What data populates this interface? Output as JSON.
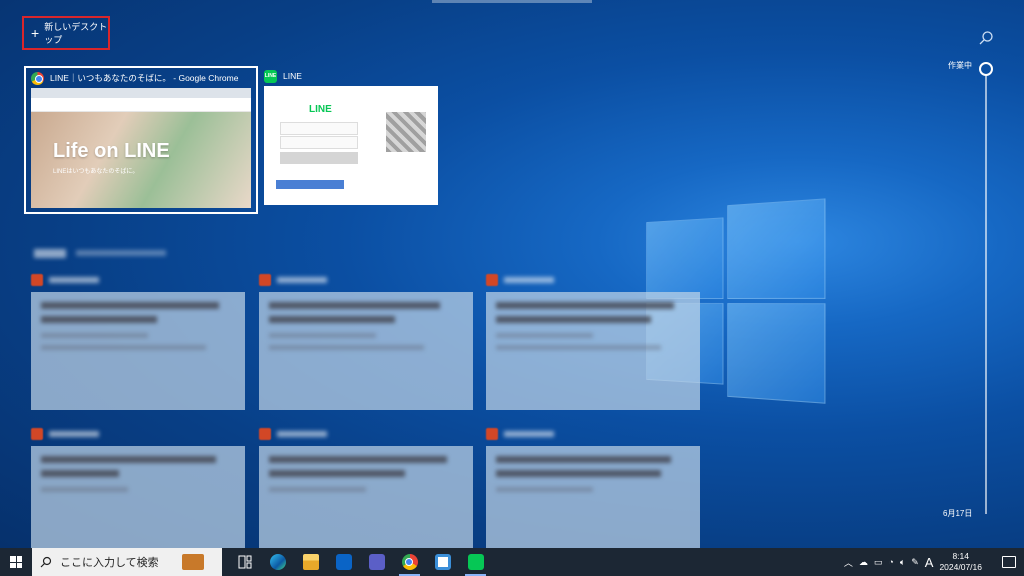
{
  "header": {
    "new_desktop_label": "新しいデスクトップ",
    "search_icon": "search-icon"
  },
  "windows": [
    {
      "app_icon": "chrome-icon",
      "title": "LINE｜いつもあなたのそばに。 - Google Chrome",
      "thumb_title": "Life on LINE",
      "thumb_sub": "LINEはいつもあなたのそばに。"
    },
    {
      "app_icon": "line-icon",
      "title": "LINE",
      "thumb_title": "LINE"
    }
  ],
  "timeline": {
    "top_label": "作業中",
    "date_label": "6月17日"
  },
  "taskbar": {
    "search_placeholder": "ここに入力して検索",
    "time": "8:14",
    "date": "2024/07/16",
    "ime": "A",
    "pinned": [
      "task-view-icon",
      "edge-icon",
      "file-explorer-icon",
      "outlook-icon",
      "teams-icon",
      "chrome-icon",
      "app-window-icon",
      "line-icon"
    ]
  },
  "colors": {
    "highlight_border": "#d9262b",
    "line_green": "#06c755",
    "taskbar": "#1c2734"
  }
}
